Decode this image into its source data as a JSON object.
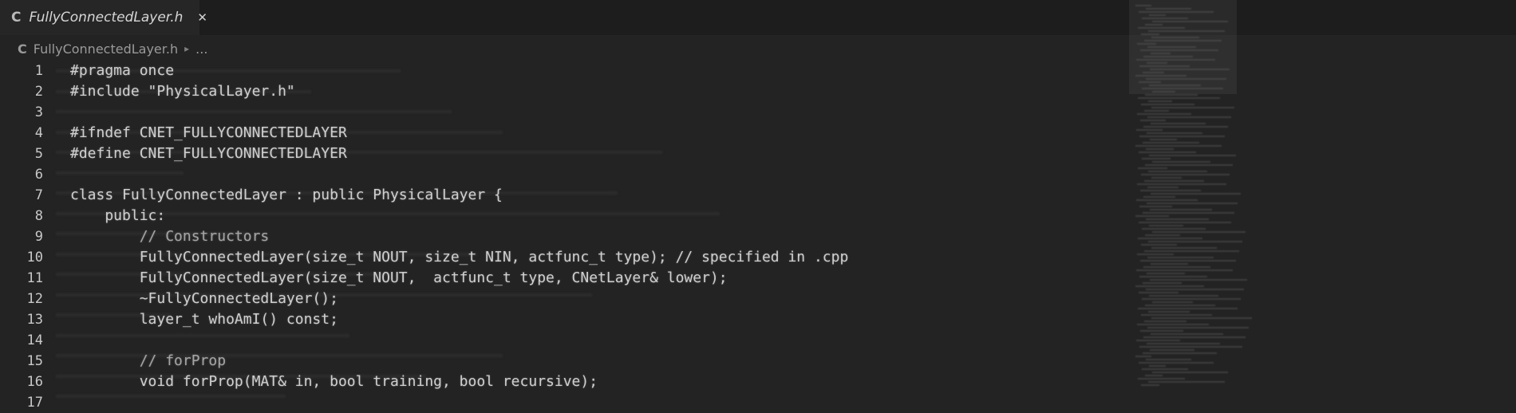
{
  "tab": {
    "icon": "C",
    "label": "FullyConnectedLayer.h",
    "close": "✕"
  },
  "breadcrumb": {
    "icon": "C",
    "file": "FullyConnectedLayer.h",
    "sep": "▸",
    "more": "..."
  },
  "lines": [
    {
      "num": "1",
      "code": "#pragma once"
    },
    {
      "num": "2",
      "code": "#include \"PhysicalLayer.h\""
    },
    {
      "num": "3",
      "code": ""
    },
    {
      "num": "4",
      "code": "#ifndef CNET_FULLYCONNECTEDLAYER"
    },
    {
      "num": "5",
      "code": "#define CNET_FULLYCONNECTEDLAYER"
    },
    {
      "num": "6",
      "code": ""
    },
    {
      "num": "7",
      "code": "class FullyConnectedLayer : public PhysicalLayer {"
    },
    {
      "num": "8",
      "code": "    public:"
    },
    {
      "num": "9",
      "code": "        // Constructors"
    },
    {
      "num": "10",
      "code": "        FullyConnectedLayer(size_t NOUT, size_t NIN, actfunc_t type); // specified in .cpp"
    },
    {
      "num": "11",
      "code": "        FullyConnectedLayer(size_t NOUT,  actfunc_t type, CNetLayer& lower);"
    },
    {
      "num": "12",
      "code": "        ~FullyConnectedLayer();"
    },
    {
      "num": "13",
      "code": "        layer_t whoAmI() const;"
    },
    {
      "num": "14",
      "code": ""
    },
    {
      "num": "15",
      "code": "        // forProp"
    },
    {
      "num": "16",
      "code": "        void forProp(MAT& in, bool training, bool recursive);"
    },
    {
      "num": "17",
      "code": ""
    }
  ]
}
